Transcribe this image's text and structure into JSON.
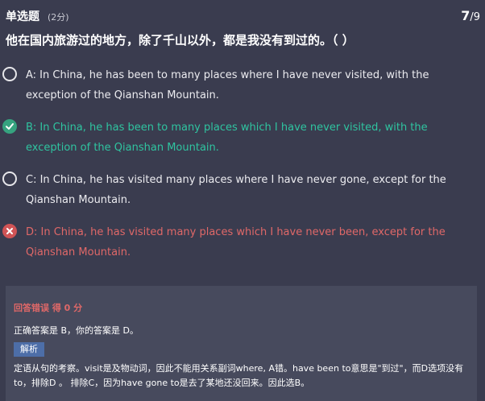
{
  "header": {
    "type_label": "单选题",
    "score_label": "(2分)",
    "progress_current": "7",
    "progress_total": "/9"
  },
  "question": "他在国内旅游过的地方，除了千山以外，都是我没有到过的。（ ）",
  "options": [
    {
      "state": "unselected",
      "text": "A: In China, he has been to many places where I have never visited, with the exception of the Qianshan Mountain."
    },
    {
      "state": "correct",
      "text": "B: In China, he has been to many places which I have never visited, with the exception of the Qianshan Mountain."
    },
    {
      "state": "unselected",
      "text": "C: In China, he has visited many places where I have never gone, except for the Qianshan Mountain."
    },
    {
      "state": "wrong",
      "text": "D: In China, he has visited many places which I have never been, except for the Qianshan Mountain."
    }
  ],
  "result": {
    "title": "回答错误 得 0 分",
    "answer_line": "正确答案是 B，你的答案是 D。",
    "explain_tag": "解析",
    "explanation": "定语从句的考察。visit是及物动词，因此不能用关系副词where, A错。have been to意思是\"到过\"，而D选项没有to，排除D 。 排除C，因为have gone to是去了某地还没回来。因此选B。"
  },
  "colors": {
    "background": "#3a3c4f",
    "correct": "#2fc4a0",
    "wrong": "#e06868",
    "tag": "#4d6ea8"
  }
}
